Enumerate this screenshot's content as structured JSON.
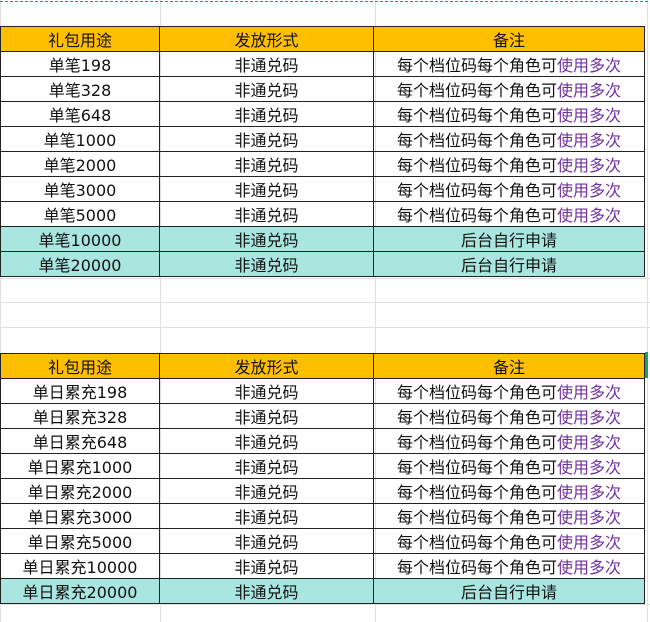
{
  "colors": {
    "header_bg": "#ffbf00",
    "highlight_bg": "#a8e6df",
    "note_accent": "#7030a0",
    "selection": "#1e9e6a"
  },
  "table1": {
    "headers": [
      "礼包用途",
      "发放形式",
      "备注"
    ],
    "rows": [
      {
        "purpose": "单笔198",
        "form": "非通兑码",
        "note_a": "每个档位码每个角色可",
        "note_b": "使用多次",
        "highlight": false
      },
      {
        "purpose": "单笔328",
        "form": "非通兑码",
        "note_a": "每个档位码每个角色可",
        "note_b": "使用多次",
        "highlight": false
      },
      {
        "purpose": "单笔648",
        "form": "非通兑码",
        "note_a": "每个档位码每个角色可",
        "note_b": "使用多次",
        "highlight": false
      },
      {
        "purpose": "单笔1000",
        "form": "非通兑码",
        "note_a": "每个档位码每个角色可",
        "note_b": "使用多次",
        "highlight": false
      },
      {
        "purpose": "单笔2000",
        "form": "非通兑码",
        "note_a": "每个档位码每个角色可",
        "note_b": "使用多次",
        "highlight": false
      },
      {
        "purpose": "单笔3000",
        "form": "非通兑码",
        "note_a": "每个档位码每个角色可",
        "note_b": "使用多次",
        "highlight": false
      },
      {
        "purpose": "单笔5000",
        "form": "非通兑码",
        "note_a": "每个档位码每个角色可",
        "note_b": "使用多次",
        "highlight": false
      },
      {
        "purpose": "单笔10000",
        "form": "非通兑码",
        "note_a": "后台自行申请",
        "note_b": "",
        "highlight": true
      },
      {
        "purpose": "单笔20000",
        "form": "非通兑码",
        "note_a": "后台自行申请",
        "note_b": "",
        "highlight": true
      }
    ]
  },
  "table2": {
    "headers": [
      "礼包用途",
      "发放形式",
      "备注"
    ],
    "rows": [
      {
        "purpose": "单日累充198",
        "form": "非通兑码",
        "note_a": "每个档位码每个角色可",
        "note_b": "使用多次",
        "highlight": false
      },
      {
        "purpose": "单日累充328",
        "form": "非通兑码",
        "note_a": "每个档位码每个角色可",
        "note_b": "使用多次",
        "highlight": false
      },
      {
        "purpose": "单日累充648",
        "form": "非通兑码",
        "note_a": "每个档位码每个角色可",
        "note_b": "使用多次",
        "highlight": false
      },
      {
        "purpose": "单日累充1000",
        "form": "非通兑码",
        "note_a": "每个档位码每个角色可",
        "note_b": "使用多次",
        "highlight": false
      },
      {
        "purpose": "单日累充2000",
        "form": "非通兑码",
        "note_a": "每个档位码每个角色可",
        "note_b": "使用多次",
        "highlight": false
      },
      {
        "purpose": "单日累充3000",
        "form": "非通兑码",
        "note_a": "每个档位码每个角色可",
        "note_b": "使用多次",
        "highlight": false
      },
      {
        "purpose": "单日累充5000",
        "form": "非通兑码",
        "note_a": "每个档位码每个角色可",
        "note_b": "使用多次",
        "highlight": false
      },
      {
        "purpose": "单日累充10000",
        "form": "非通兑码",
        "note_a": "每个档位码每个角色可",
        "note_b": "使用多次",
        "highlight": false
      },
      {
        "purpose": "单日累充20000",
        "form": "非通兑码",
        "note_a": "后台自行申请",
        "note_b": "",
        "highlight": true
      }
    ]
  }
}
